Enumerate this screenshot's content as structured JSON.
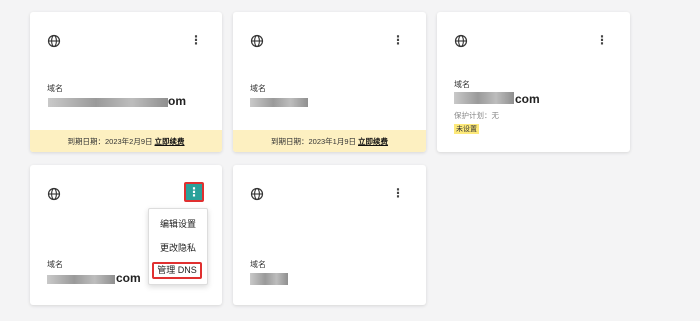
{
  "cards": [
    {
      "domain_label": "域名",
      "domain_tail": "om",
      "banner_prefix": "到期日期：",
      "banner_date": "2023年2月9日",
      "banner_action": "立即续费"
    },
    {
      "domain_label": "域名",
      "domain_tail": "",
      "banner_prefix": "到期日期：",
      "banner_date": "2023年1月9日",
      "banner_action": "立即续费"
    },
    {
      "domain_label": "域名",
      "domain_tail": "com",
      "privacy_text": "保护计划：无",
      "status_tag": "未设置"
    },
    {
      "domain_label": "域名",
      "domain_tail": "com",
      "menu": {
        "items": [
          "编辑设置",
          "更改隐私",
          "管理 DNS"
        ],
        "highlighted_index": 2
      }
    },
    {
      "domain_label": "域名",
      "domain_tail": ""
    }
  ],
  "icons": {
    "globe": "globe-icon",
    "kebab": "more-vertical-icon"
  },
  "colors": {
    "banner_bg": "#fdf0c1",
    "menu_button_bg": "#2aa19a",
    "highlight_border": "#e03030",
    "tag_bg": "#fde97a"
  }
}
